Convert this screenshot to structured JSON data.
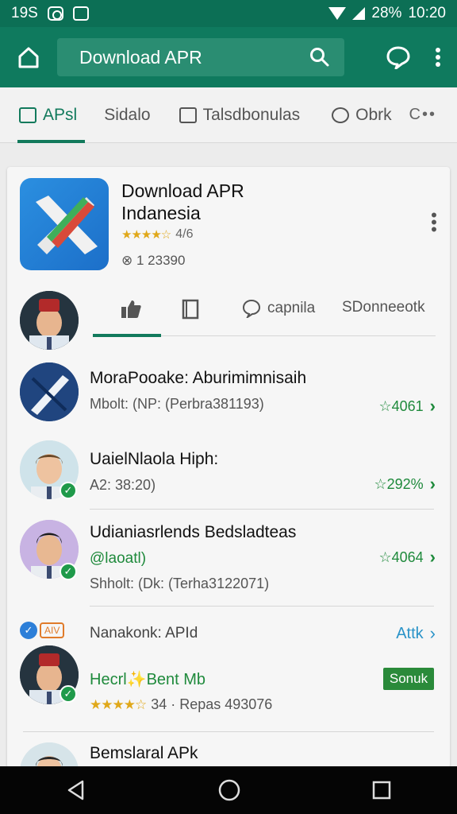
{
  "status_bar": {
    "time_left": "19S",
    "battery": "28%",
    "clock": "10:20"
  },
  "app_bar": {
    "search_text": "Download APR"
  },
  "tabs": [
    {
      "label": "APsl",
      "icon": "chat-square-icon",
      "active": true
    },
    {
      "label": "Sidalo",
      "icon": "",
      "active": false
    },
    {
      "label": "Talsdbonulas",
      "icon": "square-icon",
      "active": false
    },
    {
      "label": "Obrk",
      "icon": "chat-bubble-icon",
      "active": false
    }
  ],
  "tabs_more": "C••",
  "app": {
    "name_line1": "Download APR",
    "name_line2": "Indanesia",
    "rating_text": "4/6",
    "rating_value": 3.5,
    "downloads": "1 23390"
  },
  "sub_tabs": [
    {
      "label": "",
      "icon": "thumbs-up-icon",
      "active": true
    },
    {
      "label": "",
      "icon": "bookmark-icon",
      "active": false
    },
    {
      "label": "capnila",
      "icon": "chat-bubble-icon",
      "active": false
    },
    {
      "label": "SDonneeotk",
      "icon": "",
      "active": false
    }
  ],
  "list": [
    {
      "title": "MoraPooake: Aburimimnisaih",
      "subtitle": "Mbolt: (NP: (Perbra381193)",
      "rating": "4061"
    },
    {
      "title": "UaielNlaola Hiph:",
      "subtitle": "A2: 38:20)",
      "rating": "292%"
    },
    {
      "title": "Udianiasrlends Bedsladteas",
      "green": "@laoatl)",
      "subtitle": "Shholt: (Dk: (Terha3122071)",
      "rating": "4064"
    }
  ],
  "featured": {
    "badge": "AIV",
    "title": "Nanakonk: APId",
    "action": "Attk",
    "green": "Hecrl✨Bent Mb",
    "button": "Sonuk",
    "stars": "★★★★☆",
    "rating_text": "34 · Repas 493076"
  },
  "last_item": {
    "title": "Bemslaral APk"
  },
  "colors": {
    "primary": "#0f7a5e",
    "accent_green": "#1f8a3c",
    "status_bar": "#0c6f55"
  }
}
